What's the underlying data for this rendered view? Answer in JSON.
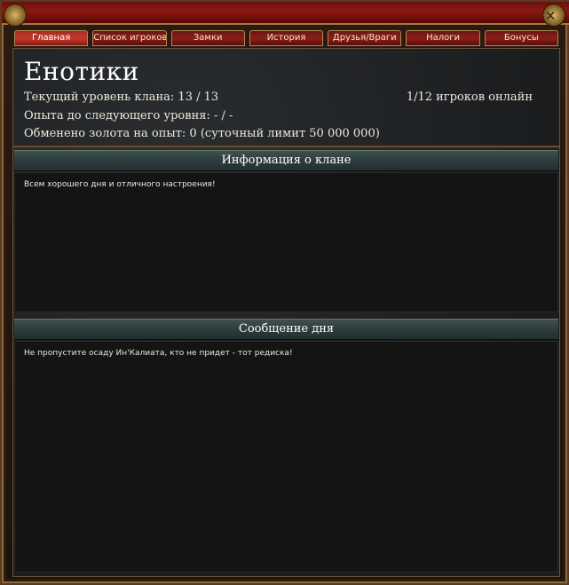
{
  "tabs": [
    {
      "label": "Главная",
      "active": true
    },
    {
      "label": "Список игроков",
      "active": false
    },
    {
      "label": "Замки",
      "active": false
    },
    {
      "label": "История",
      "active": false
    },
    {
      "label": "Друзья/Враги",
      "active": false
    },
    {
      "label": "Налоги",
      "active": false
    },
    {
      "label": "Бонусы",
      "active": false
    }
  ],
  "clan": {
    "name": "Енотики",
    "level_line": "Текущий уровень клана: 13 / 13",
    "exp_line": "Опыта до следующего уровня: - / -",
    "gold_line": "Обменено золота на опыт: 0  (суточный лимит 50 000 000)",
    "online": "1/12 игроков онлайн"
  },
  "info_section": {
    "title": "Информация о клане",
    "text": "Всем хорошего дня и отличного настроения!"
  },
  "motd_section": {
    "title": "Сообщение дня",
    "text": "Не  пропустите осаду Ин'Калиата, кто не придет  - тот редиска!"
  },
  "colors": {
    "accent": "#8b1a12",
    "gold": "#b08a4a",
    "header": "#2c3a3c"
  }
}
